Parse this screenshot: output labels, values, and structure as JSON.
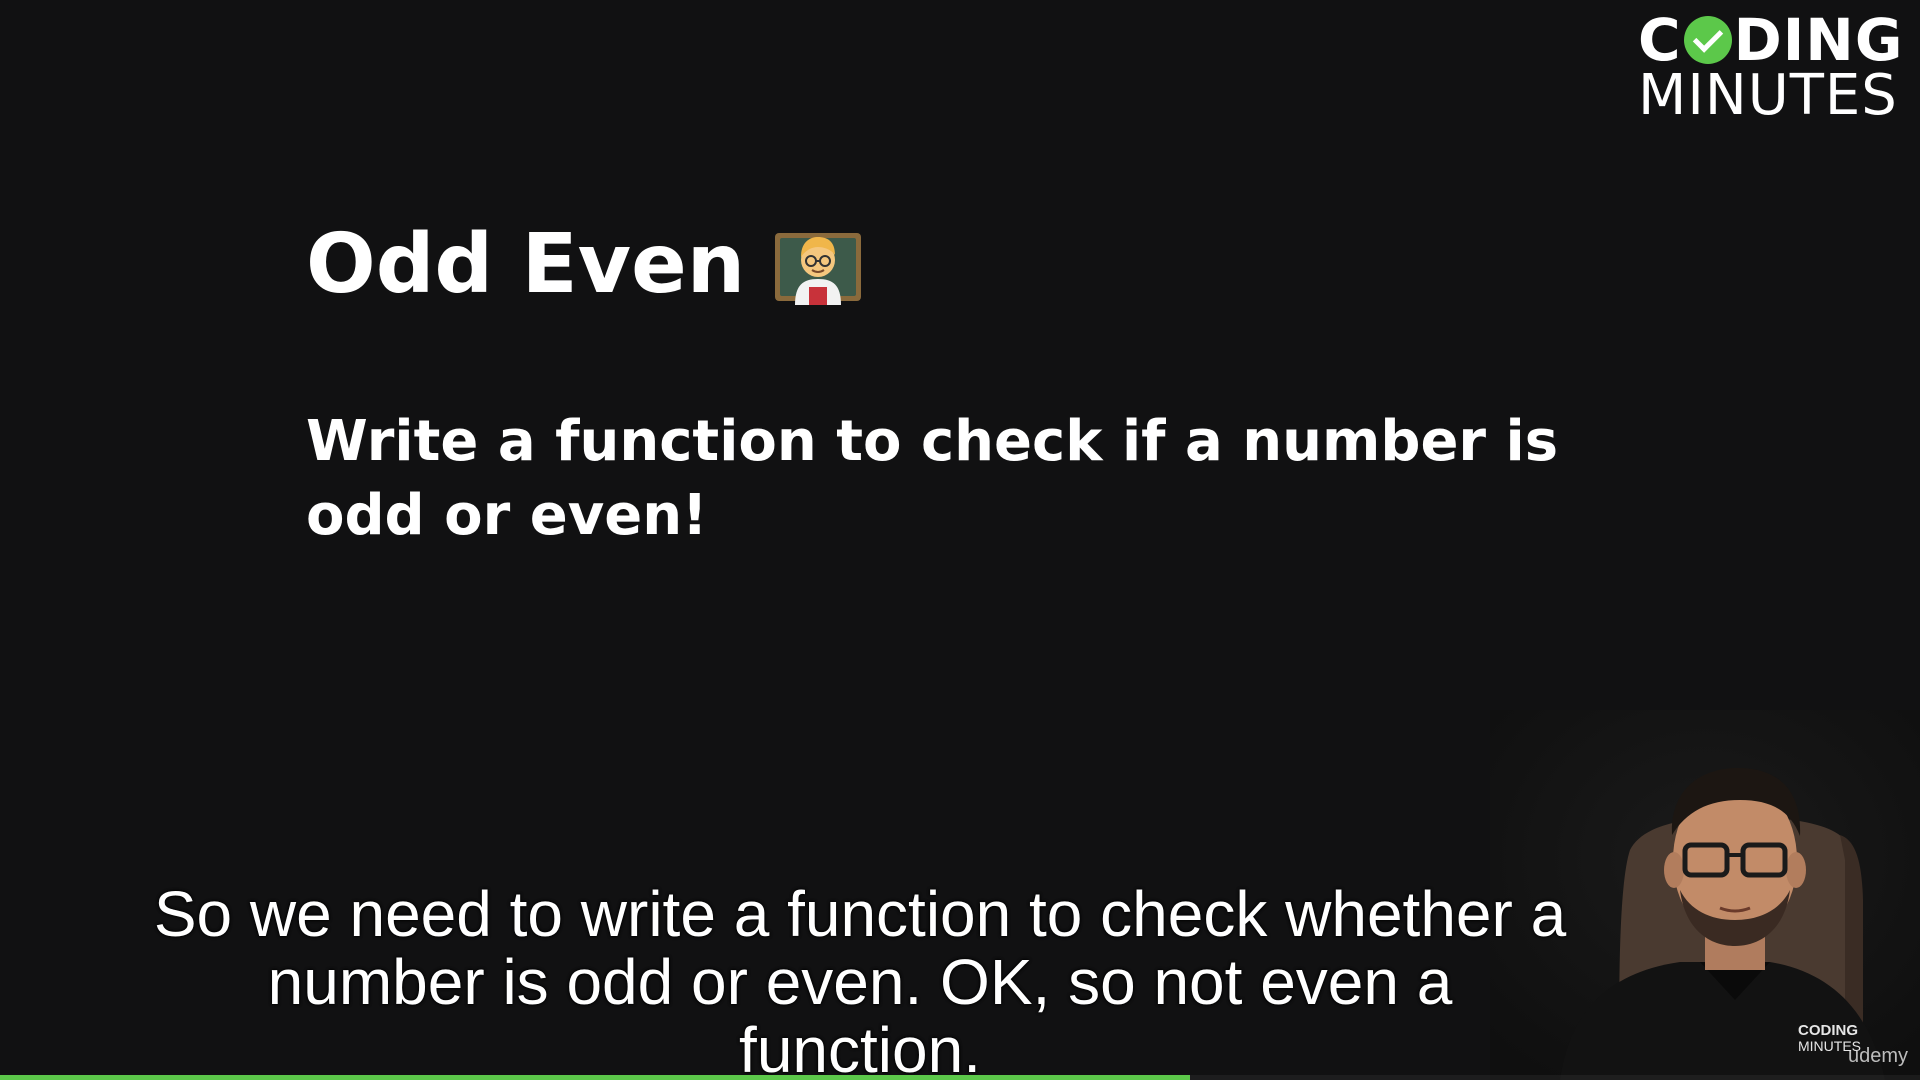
{
  "logo": {
    "line1_prefix": "C",
    "line1_suffix": "DING",
    "line2": "MINUTES"
  },
  "slide": {
    "title": "Odd Even",
    "title_emoji": "teacher-emoji",
    "body": "Write a function to check if a number is odd or even!"
  },
  "subtitle": {
    "line1": "So we need to write a function to check whether a",
    "line2": "number is odd or even. OK, so not even a function."
  },
  "webcam": {
    "watermark": "udemy"
  },
  "progress": {
    "fraction": 0.62
  },
  "colors": {
    "background": "#111112",
    "accent": "#5cc84a",
    "text": "#ffffff"
  }
}
